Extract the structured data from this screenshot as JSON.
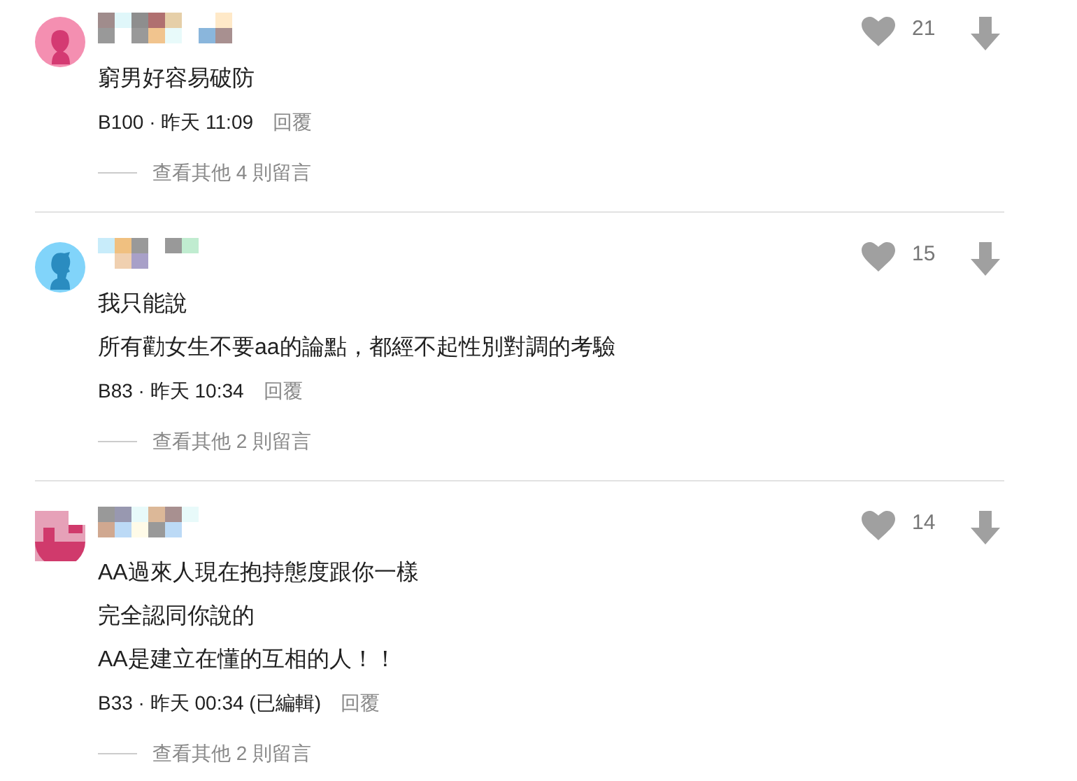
{
  "comments": [
    {
      "avatar": {
        "kind": "female",
        "color": "#f48fb1"
      },
      "lines": [
        "窮男好容易破防"
      ],
      "meta": "B100 · 昨天 11:09",
      "reply": "回覆",
      "likes": "21",
      "more_replies": "查看其他 4 則留言"
    },
    {
      "avatar": {
        "kind": "male",
        "color": "#81d4fa"
      },
      "lines": [
        "我只能說",
        "所有勸女生不要aa的論點，都經不起性別對調的考驗"
      ],
      "meta": "B83 · 昨天 10:34",
      "reply": "回覆",
      "likes": "15",
      "more_replies": "查看其他 2 則留言"
    },
    {
      "avatar": {
        "kind": "pixelated",
        "color": "#e6a1b8"
      },
      "lines": [
        "AA過來人現在抱持態度跟你一樣",
        "完全認同你說的",
        "AA是建立在懂的互相的人！！"
      ],
      "meta": "B33 · 昨天 00:34 (已編輯)",
      "reply": "回覆",
      "likes": "14",
      "more_replies": "查看其他 2 則留言"
    }
  ]
}
